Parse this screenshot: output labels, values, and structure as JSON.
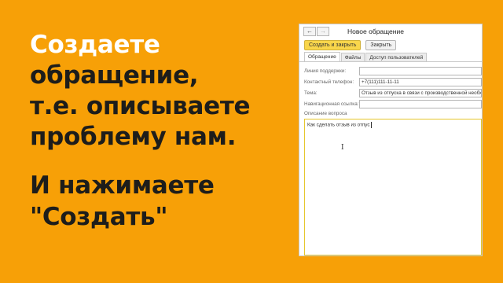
{
  "slide": {
    "headline_lines": [
      "Создаете",
      "обращение,",
      "т.е. описываете",
      "проблему нам."
    ],
    "cta_lines": [
      "И нажимаете",
      "\"Создать\""
    ]
  },
  "window": {
    "title": "Новое обращение",
    "nav_back": "←",
    "nav_forward": "→",
    "toolbar": {
      "create_close_label": "Создать и закрыть",
      "close_label": "Закрыть"
    },
    "tabs": [
      {
        "label": "Обращение",
        "active": true
      },
      {
        "label": "Файлы",
        "active": false
      },
      {
        "label": "Доступ пользователей",
        "active": false
      }
    ],
    "fields": [
      {
        "label": "Линия поддержки:",
        "value": ""
      },
      {
        "label": "Контактный телефон:",
        "value": "+7(111)111-11-11"
      },
      {
        "label": "Тема:",
        "value": "Отзыв из отпуска в связи с производственной необход"
      },
      {
        "label": "Навигационная ссылка:",
        "value": ""
      }
    ],
    "description_label": "Описание вопроса",
    "description_value": "Как сделать отзыв из отпус",
    "text_cursor_glyph": "I"
  },
  "colors": {
    "background": "#F7A007",
    "primary_button": "#F9D64B",
    "headline_dark": "#1d1d1b"
  }
}
